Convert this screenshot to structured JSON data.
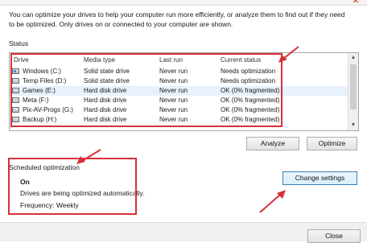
{
  "intro_text": "You can optimize your drives to help your computer run more efficiently, or analyze them to find out if they need to be optimized. Only drives on or connected to your computer are shown.",
  "status_label": "Status",
  "columns": [
    "Drive",
    "Media type",
    "Last run",
    "Current status"
  ],
  "drives": [
    {
      "drive": "Windows (C:)",
      "media": "Solid state drive",
      "last_run": "Never run",
      "status": "Needs optimization",
      "icon": "windows-drive-icon"
    },
    {
      "drive": "Temp Files (D:)",
      "media": "Solid state drive",
      "last_run": "Never run",
      "status": "Needs optimization",
      "icon": "drive-icon"
    },
    {
      "drive": "Games (E:)",
      "media": "Hard disk drive",
      "last_run": "Never run",
      "status": "OK (0% fragmented)",
      "icon": "drive-icon"
    },
    {
      "drive": "Meta (F:)",
      "media": "Hard disk drive",
      "last_run": "Never run",
      "status": "OK (0% fragmented)",
      "icon": "drive-icon"
    },
    {
      "drive": "Pix-AV-Progs (G:)",
      "media": "Hard disk drive",
      "last_run": "Never run",
      "status": "OK (0% fragmented)",
      "icon": "drive-icon"
    },
    {
      "drive": "Backup (H:)",
      "media": "Hard disk drive",
      "last_run": "Never run",
      "status": "OK (0% fragmented)",
      "icon": "drive-icon"
    }
  ],
  "buttons": {
    "analyze": "Analyze",
    "optimize": "Optimize",
    "change_settings": "Change settings",
    "close": "Close"
  },
  "scheduled": {
    "label": "Scheduled optimization",
    "state": "On",
    "description": "Drives are being optimized automatically.",
    "frequency": "Frequency: Weekly"
  },
  "annotation_color": "#d6303a"
}
